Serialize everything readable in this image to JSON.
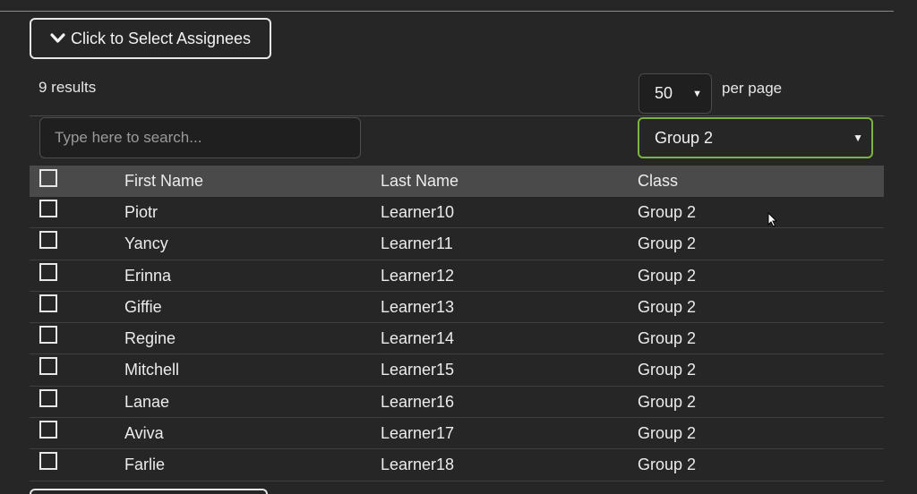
{
  "assignees_button": {
    "label": "Click to Select Assignees",
    "icon": "chevron-down-icon"
  },
  "results_text": "9 results",
  "per_page": {
    "value": "50",
    "label": "per page"
  },
  "search": {
    "placeholder": "Type here to search...",
    "value": ""
  },
  "class_filter": {
    "value": "Group 2"
  },
  "colors": {
    "background": "#262626",
    "header": "#4a4a4a",
    "filter_border": "#7cb342"
  },
  "table": {
    "headers": {
      "first": "First Name",
      "last": "Last Name",
      "class": "Class"
    },
    "rows": [
      {
        "first": "Piotr",
        "last": "Learner10",
        "class": "Group 2"
      },
      {
        "first": "Yancy",
        "last": "Learner11",
        "class": "Group 2"
      },
      {
        "first": "Erinna",
        "last": "Learner12",
        "class": "Group 2"
      },
      {
        "first": "Giffie",
        "last": "Learner13",
        "class": "Group 2"
      },
      {
        "first": "Regine",
        "last": "Learner14",
        "class": "Group 2"
      },
      {
        "first": "Mitchell",
        "last": "Learner15",
        "class": "Group 2"
      },
      {
        "first": "Lanae",
        "last": "Learner16",
        "class": "Group 2"
      },
      {
        "first": "Aviva",
        "last": "Learner17",
        "class": "Group 2"
      },
      {
        "first": "Farlie",
        "last": "Learner18",
        "class": "Group 2"
      }
    ]
  }
}
